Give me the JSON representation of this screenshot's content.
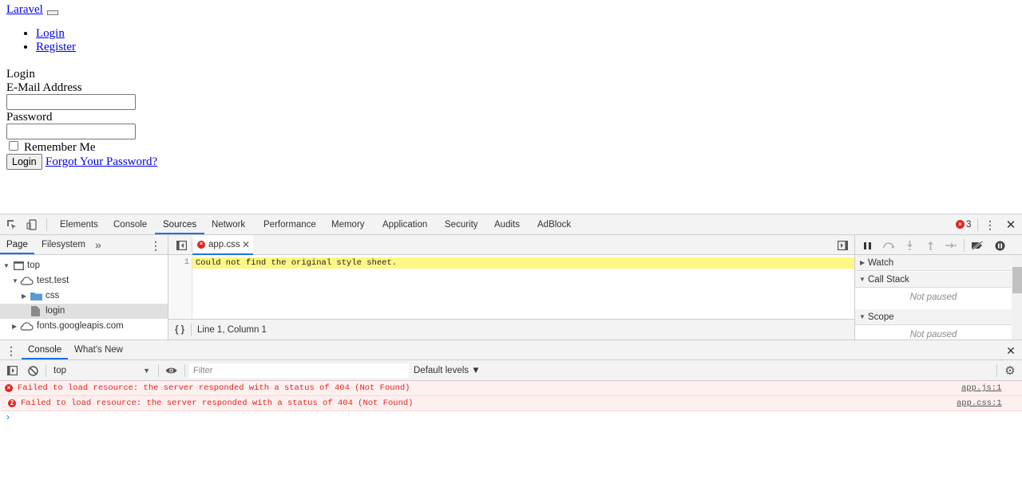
{
  "page": {
    "brand": "Laravel",
    "nav": [
      "Login",
      "Register"
    ],
    "heading": "Login",
    "email_label": "E-Mail Address",
    "password_label": "Password",
    "remember_label": "Remember Me",
    "login_button": "Login",
    "forgot_link": "Forgot Your Password?"
  },
  "devtools": {
    "tabs": [
      "Elements",
      "Console",
      "Sources",
      "Network",
      "Performance",
      "Memory",
      "Application",
      "Security",
      "Audits",
      "AdBlock"
    ],
    "active_tab": "Sources",
    "error_count": "3",
    "navigator": {
      "tabs": [
        "Page",
        "Filesystem"
      ],
      "more": "»",
      "tree": [
        "top",
        "test.test",
        "css",
        "login",
        "fonts.googleapis.com"
      ]
    },
    "editor": {
      "file_tab": "app.css",
      "line_number": "1",
      "line_text": "Could not find the original style sheet.",
      "format_label": "{ }",
      "status": "Line 1, Column 1"
    },
    "debugger": {
      "sections": [
        "Watch",
        "Call Stack",
        "Scope"
      ],
      "not_paused": "Not paused"
    },
    "drawer": {
      "tabs": [
        "Console",
        "What's New"
      ],
      "context": "top",
      "filter_placeholder": "Filter",
      "levels": "Default levels ▼",
      "messages": [
        {
          "text": "Failed to load resource: the server responded with a status of 404 (Not Found)",
          "source": "app.js:1",
          "badge": "×"
        },
        {
          "text": "Failed to load resource: the server responded with a status of 404 (Not Found)",
          "source": "app.css:1",
          "badge": "2"
        }
      ],
      "prompt": "›"
    }
  }
}
